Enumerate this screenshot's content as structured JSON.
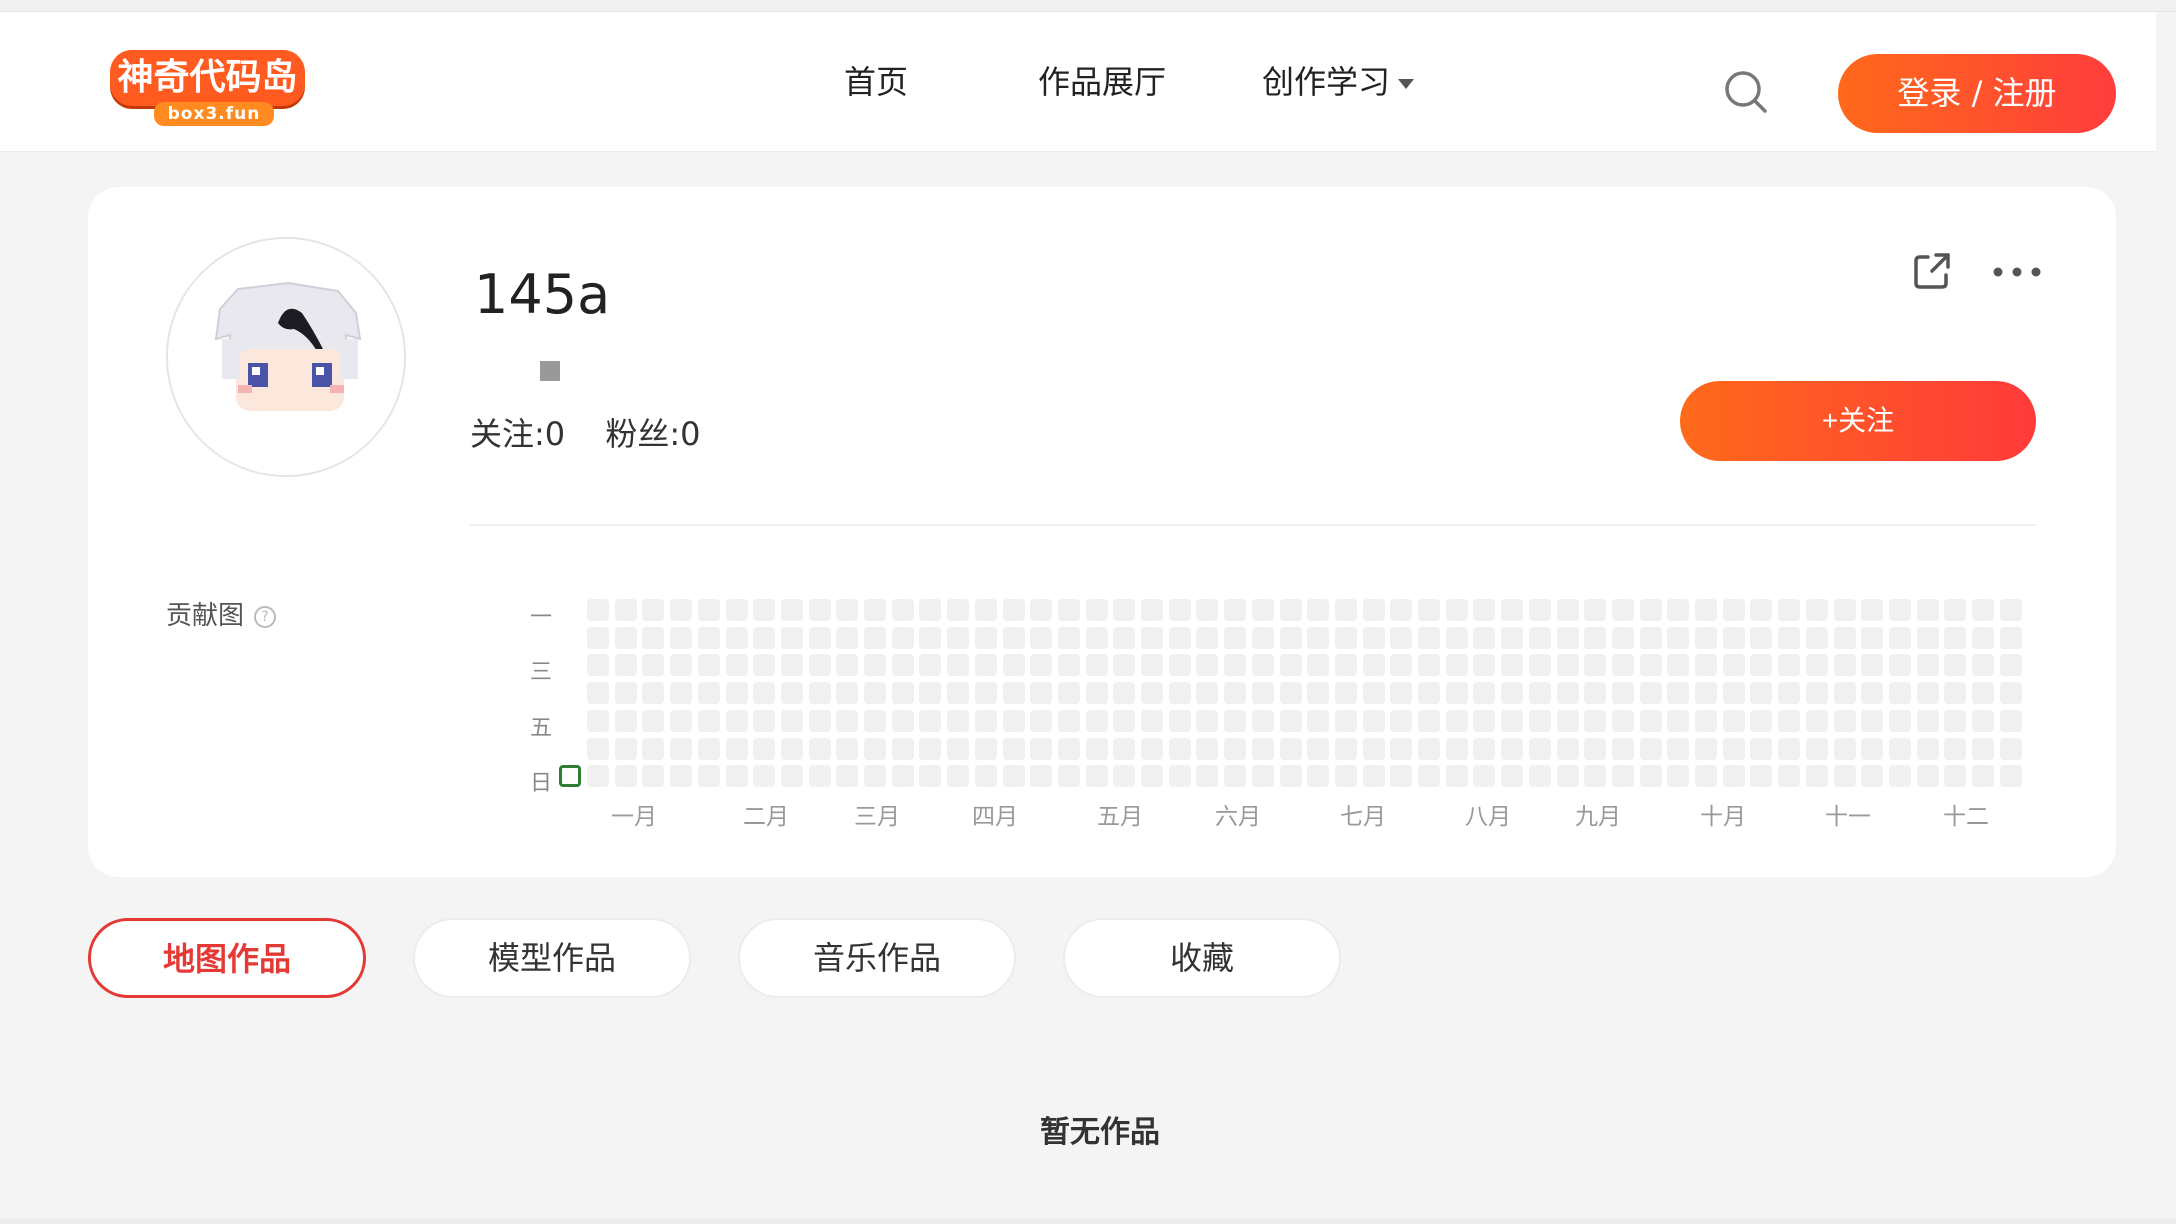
{
  "header": {
    "logo_text": "神奇代码岛",
    "logo_sub": "box3.fun",
    "nav": [
      {
        "label": "首页"
      },
      {
        "label": "作品展厅"
      },
      {
        "label": "创作学习"
      }
    ],
    "login_label": "登录 / 注册"
  },
  "profile": {
    "username": "145a",
    "following": "关注:0",
    "followers": "粉丝:0",
    "follow_button": "+关注"
  },
  "contributions": {
    "label": "贡献图",
    "help_symbol": "?",
    "day_labels": [
      "一",
      "三",
      "五",
      "日"
    ],
    "months": [
      "一月",
      "二月",
      "三月",
      "四月",
      "五月",
      "六月",
      "七月",
      "八月",
      "九月",
      "十月",
      "十一",
      "十二"
    ],
    "cell_color": "#f0f0f0",
    "today_border_color": "#2e7d32"
  },
  "tabs": [
    {
      "label": "地图作品",
      "active": true
    },
    {
      "label": "模型作品",
      "active": false
    },
    {
      "label": "音乐作品",
      "active": false
    },
    {
      "label": "收藏",
      "active": false
    }
  ],
  "empty_state": "暂无作品",
  "colors": {
    "accent_start": "#ff6a1a",
    "accent_end": "#ff3d3d",
    "active_tab": "#e53935"
  }
}
